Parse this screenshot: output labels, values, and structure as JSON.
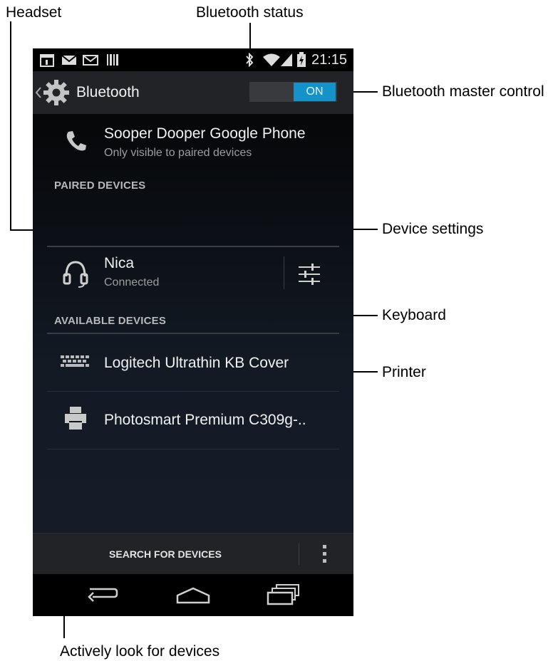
{
  "callouts": {
    "headset": "Headset",
    "bluetooth_status": "Bluetooth status",
    "master_control": "Bluetooth master control",
    "device_settings": "Device settings",
    "keyboard": "Keyboard",
    "printer": "Printer",
    "search": "Actively look for devices"
  },
  "status_bar": {
    "time": "21:15",
    "icons": [
      "calendar-icon",
      "gmail-icon",
      "email-icon",
      "barcode-icon",
      "bluetooth-icon",
      "wifi-icon",
      "signal-icon",
      "battery-icon"
    ]
  },
  "action_bar": {
    "title": "Bluetooth",
    "toggle_label": "ON",
    "toggle_color": "#1592c9"
  },
  "this_device": {
    "name": "Sooper Dooper Google Phone",
    "subtitle": "Only visible to paired devices"
  },
  "paired": {
    "header": "PAIRED DEVICES",
    "devices": [
      {
        "name": "Nica",
        "status": "Connected",
        "icon": "headset-icon"
      }
    ]
  },
  "available": {
    "header": "AVAILABLE DEVICES",
    "devices": [
      {
        "name": "Logitech Ultrathin KB Cover",
        "icon": "keyboard-icon"
      },
      {
        "name": "Photosmart Premium C309g-..",
        "icon": "printer-icon"
      }
    ]
  },
  "bottom_bar": {
    "search_label": "SEARCH FOR DEVICES"
  }
}
